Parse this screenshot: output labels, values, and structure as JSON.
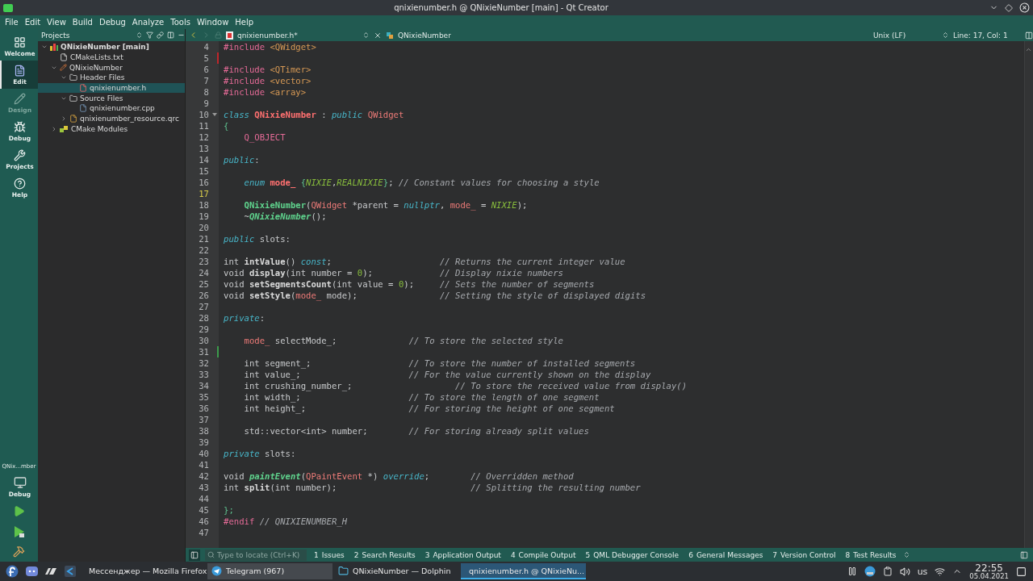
{
  "window": {
    "title": "qnixienumber.h @ QNixieNumber [main] - Qt Creator"
  },
  "menu": [
    "File",
    "Edit",
    "View",
    "Build",
    "Debug",
    "Analyze",
    "Tools",
    "Window",
    "Help"
  ],
  "modes": [
    {
      "label": "Welcome",
      "kind": "welcome",
      "selected": false,
      "disabled": false
    },
    {
      "label": "Edit",
      "kind": "edit",
      "selected": true,
      "disabled": false
    },
    {
      "label": "Design",
      "kind": "design",
      "selected": false,
      "disabled": true
    },
    {
      "label": "Debug",
      "kind": "debug",
      "selected": false,
      "disabled": false
    },
    {
      "label": "Projects",
      "kind": "projects",
      "selected": false,
      "disabled": false
    },
    {
      "label": "Help",
      "kind": "help",
      "selected": false,
      "disabled": false
    }
  ],
  "run_target": {
    "project": "QNix...mber",
    "config": "Debug"
  },
  "projects_panel": {
    "title": "Projects",
    "tree": [
      {
        "label": "QNixieNumber [main]",
        "kind": "project",
        "expanded": true,
        "selected": false,
        "children": [
          {
            "label": "CMakeLists.txt",
            "kind": "cmake",
            "selected": false
          },
          {
            "label": "QNixieNumber",
            "kind": "product",
            "expanded": true,
            "selected": false,
            "children": [
              {
                "label": "Header Files",
                "kind": "folder",
                "expanded": true,
                "selected": false,
                "children": [
                  {
                    "label": "qnixienumber.h",
                    "kind": "header",
                    "selected": true
                  }
                ]
              },
              {
                "label": "Source Files",
                "kind": "folder",
                "expanded": true,
                "selected": false,
                "children": [
                  {
                    "label": "qnixienumber.cpp",
                    "kind": "source",
                    "selected": false
                  }
                ]
              },
              {
                "label": "qnixienumber_resource.qrc",
                "kind": "resource",
                "expanded": false,
                "selected": false
              }
            ]
          },
          {
            "label": "CMake Modules",
            "kind": "modules",
            "expanded": false,
            "selected": false
          }
        ]
      }
    ]
  },
  "editor": {
    "file_tab": "qnixienumber.h*",
    "symbol": "QNixieNumber",
    "line_ending": "Unix (LF)",
    "position": "Line: 17, Col: 1",
    "lines": [
      {
        "number": "4",
        "current": false,
        "tokens": [
          {
            "kind": "pp",
            "text": "#include "
          },
          {
            "kind": "inc",
            "text": "<QWidget>"
          }
        ]
      },
      {
        "number": "5",
        "current": false,
        "color": "#c0262b"
      },
      {
        "number": "6",
        "current": false,
        "tokens": [
          {
            "kind": "pp",
            "text": "#include "
          },
          {
            "kind": "inc",
            "text": "<QTimer>"
          }
        ]
      },
      {
        "number": "7",
        "current": false,
        "tokens": [
          {
            "kind": "pp",
            "text": "#include "
          },
          {
            "kind": "inc",
            "text": "<vector>"
          }
        ]
      },
      {
        "number": "8",
        "current": false,
        "tokens": [
          {
            "kind": "pp",
            "text": "#include "
          },
          {
            "kind": "inc",
            "text": "<array>"
          }
        ]
      },
      {
        "number": "9",
        "current": false
      },
      {
        "number": "10",
        "current": false,
        "fold": true,
        "tokens": [
          {
            "kind": "kw",
            "text": "class "
          },
          {
            "kind": "cls",
            "text": "QNixieNumber"
          },
          {
            "kind": "p",
            "text": " : "
          },
          {
            "kind": "kw",
            "text": "public "
          },
          {
            "kind": "ty",
            "text": "QWidget"
          }
        ]
      },
      {
        "number": "11",
        "current": false,
        "tokens": [
          {
            "kind": "br",
            "text": "{"
          }
        ]
      },
      {
        "number": "12",
        "current": false,
        "tokens": [
          {
            "kind": "mac",
            "text": "    Q_OBJECT"
          }
        ]
      },
      {
        "number": "13",
        "current": false
      },
      {
        "number": "14",
        "current": false,
        "tokens": [
          {
            "kind": "kw",
            "text": "public"
          },
          {
            "kind": "p",
            "text": ":"
          }
        ]
      },
      {
        "number": "15",
        "current": false
      },
      {
        "number": "16",
        "current": false,
        "tokens": [
          {
            "kind": "kw",
            "text": "    enum "
          },
          {
            "kind": "cls",
            "text": "mode_"
          },
          {
            "kind": "br",
            "text": " {"
          },
          {
            "kind": "en",
            "text": "NIXIE"
          },
          {
            "kind": "p",
            "text": ","
          },
          {
            "kind": "en",
            "text": "REALNIXIE"
          },
          {
            "kind": "br",
            "text": "}"
          },
          {
            "kind": "p",
            "text": "; "
          },
          {
            "kind": "cm",
            "text": "// Constant values for choosing a style"
          }
        ]
      },
      {
        "number": "17",
        "current": true
      },
      {
        "number": "18",
        "current": false,
        "tokens": [
          {
            "kind": "fn",
            "text": "    QNixieNumber"
          },
          {
            "kind": "p",
            "text": "("
          },
          {
            "kind": "ty",
            "text": "QWidget"
          },
          {
            "kind": "p",
            "text": " *parent = "
          },
          {
            "kind": "kw",
            "text": "nullptr"
          },
          {
            "kind": "p",
            "text": ", "
          },
          {
            "kind": "ty",
            "text": "mode_"
          },
          {
            "kind": "p",
            "text": " = "
          },
          {
            "kind": "en",
            "text": "NIXIE"
          },
          {
            "kind": "p",
            "text": ");"
          }
        ]
      },
      {
        "number": "19",
        "current": false,
        "tokens": [
          {
            "kind": "p",
            "text": "    ~"
          },
          {
            "kind": "fnv",
            "text": "QNixieNumber"
          },
          {
            "kind": "p",
            "text": "();"
          }
        ]
      },
      {
        "number": "20",
        "current": false
      },
      {
        "number": "21",
        "current": false,
        "tokens": [
          {
            "kind": "kw",
            "text": "public"
          },
          {
            "kind": "p",
            "text": " slots:"
          }
        ]
      },
      {
        "number": "22",
        "current": false
      },
      {
        "number": "23",
        "current": false,
        "tokens": [
          {
            "kind": "p",
            "text": "int "
          },
          {
            "kind": "fnd",
            "text": "intValue"
          },
          {
            "kind": "p",
            "text": "() "
          },
          {
            "kind": "kw",
            "text": "const"
          },
          {
            "kind": "p",
            "text": ";                     "
          },
          {
            "kind": "cm",
            "text": "// Returns the current integer value"
          }
        ]
      },
      {
        "number": "24",
        "current": false,
        "tokens": [
          {
            "kind": "p",
            "text": "void "
          },
          {
            "kind": "fnd",
            "text": "display"
          },
          {
            "kind": "p",
            "text": "(int number = "
          },
          {
            "kind": "num",
            "text": "0"
          },
          {
            "kind": "p",
            "text": ");             "
          },
          {
            "kind": "cm",
            "text": "// Display nixie numbers"
          }
        ]
      },
      {
        "number": "25",
        "current": false,
        "tokens": [
          {
            "kind": "p",
            "text": "void "
          },
          {
            "kind": "fnd",
            "text": "setSegmentsCount"
          },
          {
            "kind": "p",
            "text": "(int value = "
          },
          {
            "kind": "num",
            "text": "0"
          },
          {
            "kind": "p",
            "text": ");     "
          },
          {
            "kind": "cm",
            "text": "// Sets the number of segments"
          }
        ]
      },
      {
        "number": "26",
        "current": false,
        "tokens": [
          {
            "kind": "p",
            "text": "void "
          },
          {
            "kind": "fnd",
            "text": "setStyle"
          },
          {
            "kind": "p",
            "text": "("
          },
          {
            "kind": "ty",
            "text": "mode_"
          },
          {
            "kind": "p",
            "text": " mode);                "
          },
          {
            "kind": "cm",
            "text": "// Setting the style of displayed digits"
          }
        ]
      },
      {
        "number": "27",
        "current": false
      },
      {
        "number": "28",
        "current": false,
        "tokens": [
          {
            "kind": "kw",
            "text": "private"
          },
          {
            "kind": "p",
            "text": ":"
          }
        ]
      },
      {
        "number": "29",
        "current": false
      },
      {
        "number": "30",
        "current": false,
        "tokens": [
          {
            "kind": "ty",
            "text": "    mode_"
          },
          {
            "kind": "p",
            "text": " selectMode_;              "
          },
          {
            "kind": "cm",
            "text": "// To store the selected style"
          }
        ]
      },
      {
        "number": "31",
        "current": false,
        "color": "#3c9a4b"
      },
      {
        "number": "32",
        "current": false,
        "tokens": [
          {
            "kind": "p",
            "text": "    int segment_;                   "
          },
          {
            "kind": "cm",
            "text": "// To store the number of installed segments"
          }
        ]
      },
      {
        "number": "33",
        "current": false,
        "tokens": [
          {
            "kind": "p",
            "text": "    int value_;                     "
          },
          {
            "kind": "cm",
            "text": "// For the value currently shown on the display"
          }
        ]
      },
      {
        "number": "34",
        "current": false,
        "tokens": [
          {
            "kind": "p",
            "text": "    int crushing_number_;                    "
          },
          {
            "kind": "cm",
            "text": "// To store the received value from display()"
          }
        ]
      },
      {
        "number": "35",
        "current": false,
        "tokens": [
          {
            "kind": "p",
            "text": "    int width_;                     "
          },
          {
            "kind": "cm",
            "text": "// To store the length of one segment"
          }
        ]
      },
      {
        "number": "36",
        "current": false,
        "tokens": [
          {
            "kind": "p",
            "text": "    int height_;                    "
          },
          {
            "kind": "cm",
            "text": "// For storing the height of one segment"
          }
        ]
      },
      {
        "number": "37",
        "current": false
      },
      {
        "number": "38",
        "current": false,
        "tokens": [
          {
            "kind": "p",
            "text": "    std::vector<int> number;        "
          },
          {
            "kind": "cm",
            "text": "// For storing already split values"
          }
        ]
      },
      {
        "number": "39",
        "current": false
      },
      {
        "number": "40",
        "current": false,
        "tokens": [
          {
            "kind": "kw",
            "text": "private"
          },
          {
            "kind": "p",
            "text": " slots:"
          }
        ]
      },
      {
        "number": "41",
        "current": false
      },
      {
        "number": "42",
        "current": false,
        "tokens": [
          {
            "kind": "p",
            "text": "void "
          },
          {
            "kind": "fnv",
            "text": "paintEvent"
          },
          {
            "kind": "p",
            "text": "("
          },
          {
            "kind": "ty",
            "text": "QPaintEvent"
          },
          {
            "kind": "p",
            "text": " *) "
          },
          {
            "kind": "kw",
            "text": "override"
          },
          {
            "kind": "p",
            "text": ";        "
          },
          {
            "kind": "cm",
            "text": "// Overridden method"
          }
        ]
      },
      {
        "number": "43",
        "current": false,
        "tokens": [
          {
            "kind": "p",
            "text": "int "
          },
          {
            "kind": "fnd",
            "text": "split"
          },
          {
            "kind": "p",
            "text": "(int number);                          "
          },
          {
            "kind": "cm",
            "text": "// Splitting the resulting number"
          }
        ]
      },
      {
        "number": "44",
        "current": false
      },
      {
        "number": "45",
        "current": false,
        "tokens": [
          {
            "kind": "br",
            "text": "};"
          }
        ]
      },
      {
        "number": "46",
        "current": false,
        "tokens": [
          {
            "kind": "pp",
            "text": "#endif "
          },
          {
            "kind": "cm",
            "text": "// QNIXIENUMBER_H"
          }
        ]
      },
      {
        "number": "47",
        "current": false
      }
    ]
  },
  "output_pane": {
    "locate_placeholder": "Type to locate (Ctrl+K)",
    "tabs": [
      {
        "number": "1",
        "label": "Issues"
      },
      {
        "number": "2",
        "label": "Search Results"
      },
      {
        "number": "3",
        "label": "Application Output"
      },
      {
        "number": "4",
        "label": "Compile Output"
      },
      {
        "number": "5",
        "label": "QML Debugger Console"
      },
      {
        "number": "6",
        "label": "General Messages"
      },
      {
        "number": "7",
        "label": "Version Control"
      },
      {
        "number": "8",
        "label": "Test Results"
      }
    ]
  },
  "taskbar": {
    "tasks": [
      {
        "label": "Мессенджер — Mozilla Firefox",
        "kind": "browser",
        "selected": false,
        "hovered": false
      },
      {
        "label": "Telegram (967)",
        "kind": "messenger",
        "selected": false,
        "hovered": true
      },
      {
        "label": "QNixieNumber — Dolphin",
        "kind": "files",
        "selected": false,
        "hovered": false
      },
      {
        "label": "qnixienumber.h @ QNixieNu...",
        "kind": "ide",
        "selected": true,
        "hovered": false
      }
    ],
    "keyboard_layout": "us",
    "time": "22:55",
    "date": "05.04.2021"
  }
}
